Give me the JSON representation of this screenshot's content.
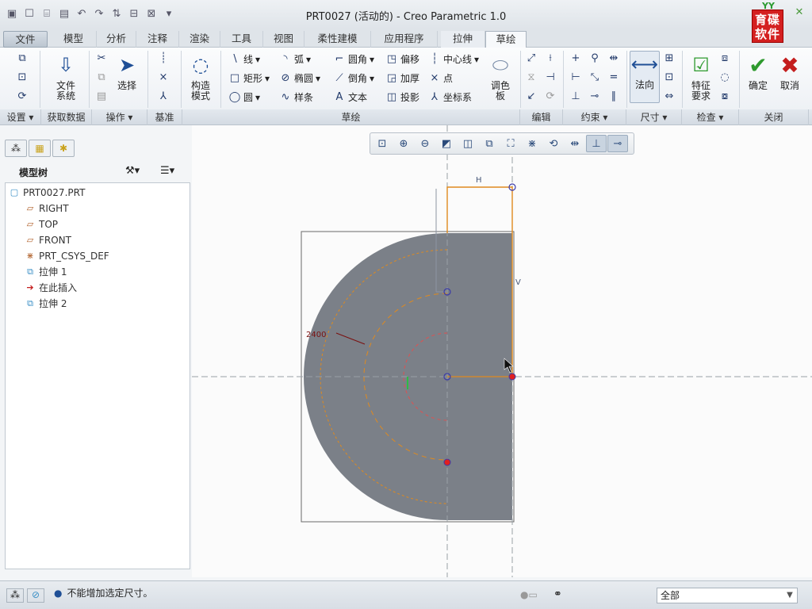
{
  "title": "PRT0027 (活动的) - Creo Parametric 1.0",
  "logo": {
    "top": "YY",
    "text": "育碟软件"
  },
  "tabs": {
    "file": "文件",
    "model": "模型",
    "analysis": "分析",
    "annotate": "注释",
    "render": "渲染",
    "tools": "工具",
    "view": "视图",
    "flexible": "柔性建模",
    "apps": "应用程序",
    "extrude": "拉伸",
    "sketch": "草绘"
  },
  "ribbon": {
    "file_system": "文件\n系统",
    "select": "选择",
    "construct_mode": "构造\n模式",
    "line": "线",
    "arc": "弧",
    "fillet": "圆角",
    "offset": "偏移",
    "centerline": "中心线",
    "rectangle": "矩形",
    "ellipse": "椭圆",
    "chamfer": "倒角",
    "thicken": "加厚",
    "point": "点",
    "circle": "圆",
    "spline": "样条",
    "text": "文本",
    "project": "投影",
    "csys": "坐标系",
    "palette": "调色\n板",
    "normal": "法向",
    "feature_req": "特征\n要求",
    "ok": "确定",
    "cancel": "取消"
  },
  "groups": {
    "setup": "设置",
    "get_data": "获取数据",
    "operations": "操作",
    "datum": "基准",
    "sketching": "草绘",
    "editing": "编辑",
    "constrain": "约束",
    "dimension": "尺寸",
    "inspect": "检查",
    "close": "关闭"
  },
  "model_tree": {
    "title": "模型树",
    "items": [
      "PRT0027.PRT",
      "RIGHT",
      "TOP",
      "FRONT",
      "PRT_CSYS_DEF",
      "拉伸 1",
      "在此插入",
      "拉伸 2"
    ]
  },
  "sketch": {
    "dim_h": "H",
    "dim_v": "V",
    "dim_radius": "2400"
  },
  "status": {
    "message": "不能增加选定尺寸。",
    "filter": "全部"
  },
  "colors": {
    "accent_blue": "#1f4f96",
    "ok_green": "#2e9a2e",
    "cancel_red": "#c41e1e",
    "sketch_orange": "#e08a1e",
    "solid_gray": "#7b8088"
  }
}
